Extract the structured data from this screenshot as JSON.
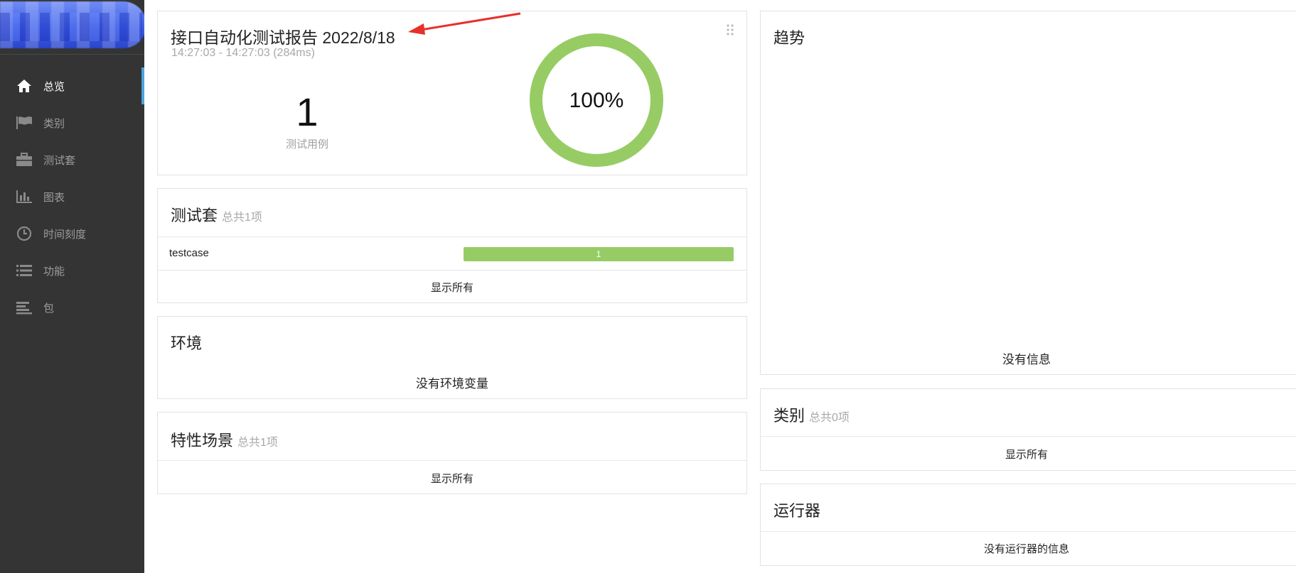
{
  "sidebar": {
    "items": [
      {
        "label": "总览",
        "icon": "home-icon",
        "active": true
      },
      {
        "label": "类别",
        "icon": "flag-icon",
        "active": false
      },
      {
        "label": "测试套",
        "icon": "briefcase-icon",
        "active": false
      },
      {
        "label": "图表",
        "icon": "bar-chart-icon",
        "active": false
      },
      {
        "label": "时间刻度",
        "icon": "clock-icon",
        "active": false
      },
      {
        "label": "功能",
        "icon": "list-icon",
        "active": false
      },
      {
        "label": "包",
        "icon": "align-left-icon",
        "active": false
      }
    ]
  },
  "summary": {
    "title": "接口自动化测试报告 2022/8/18",
    "time_range": "14:27:03 - 14:27:03 (284ms)",
    "test_count": "1",
    "test_count_label": "测试用例",
    "pass_percent_label": "100%",
    "pass_fraction": 1.0
  },
  "suites": {
    "title": "测试套",
    "subtitle": "总共1项",
    "rows": [
      {
        "name": "testcase",
        "passed": "1",
        "fraction": 1.0
      }
    ],
    "show_all": "显示所有"
  },
  "environment": {
    "title": "环境",
    "empty": "没有环境变量"
  },
  "features": {
    "title": "特性场景",
    "subtitle": "总共1项",
    "show_all": "显示所有"
  },
  "trend": {
    "title": "趋势",
    "empty": "没有信息"
  },
  "categories": {
    "title": "类别",
    "subtitle": "总共0项",
    "show_all": "显示所有"
  },
  "executors": {
    "title": "运行器",
    "empty": "没有运行器的信息"
  },
  "colors": {
    "passed": "#97cc64",
    "sidebar_bg": "#343434",
    "active_indicator": "#4aa3df",
    "annotation_arrow": "#e8302a"
  }
}
